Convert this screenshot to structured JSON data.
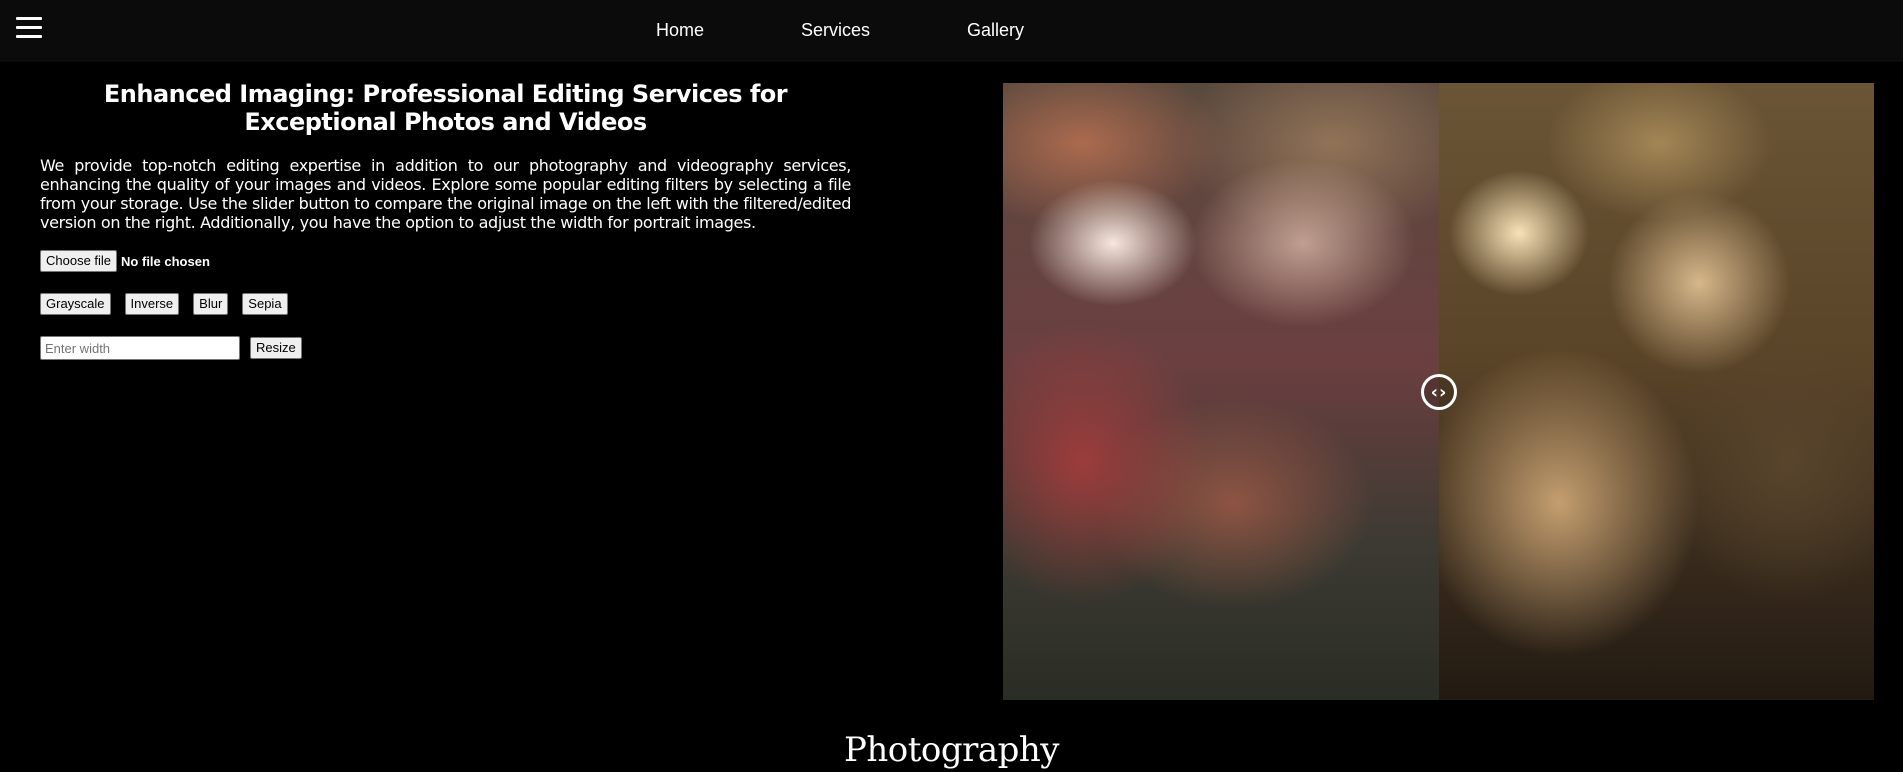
{
  "header": {
    "menu_icon": "hamburger-menu-icon",
    "nav": {
      "home": "Home",
      "services": "Services",
      "gallery": "Gallery"
    }
  },
  "editor": {
    "title": "Enhanced Imaging: Professional Editing Services for Exceptional Photos and Videos",
    "description": "We provide top-notch editing expertise in addition to our photography and videography services, enhancing the quality of your images and videos. Explore some popular editing filters by selecting a file from your storage. Use the slider button to compare the original image on the left with the filtered/edited version on the right. Additionally, you have the option to adjust the width for portrait images.",
    "file_button": "Choose file",
    "file_status": "No file chosen",
    "filters": {
      "grayscale": "Grayscale",
      "inverse": "Inverse",
      "blur": "Blur",
      "sepia": "Sepia"
    },
    "width_placeholder": "Enter width",
    "resize_button": "Resize"
  },
  "comparison": {
    "slider_icon": "chevron-left-right-icon",
    "slider_glyph": "‹›",
    "slider_position_percent": 50,
    "original_side": "left",
    "edited_side": "right",
    "edited_filter": "sepia"
  },
  "section": {
    "title": "Photography"
  }
}
